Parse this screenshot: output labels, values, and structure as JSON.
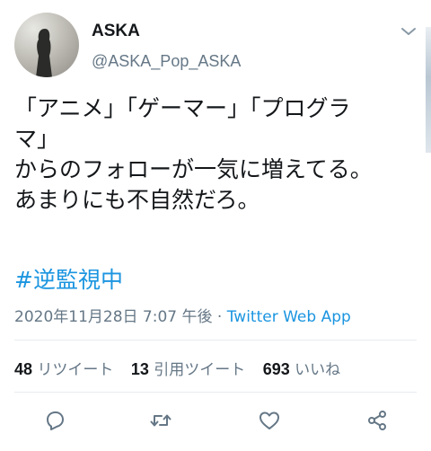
{
  "user": {
    "display_name": "ASKA",
    "handle": "@ASKA_Pop_ASKA",
    "avatar_icon": "silhouette-avatar-icon"
  },
  "tweet": {
    "lines": [
      "「アニメ」「ゲーマー」「プログラ",
      "マ」",
      "からのフォローが一気に増えてる。",
      "あまりにも不自然だろ。"
    ],
    "hashtag": "#逆監視中"
  },
  "meta": {
    "timestamp": "2020年11月28日 7:07 午後",
    "separator": " · ",
    "source": "Twitter Web App"
  },
  "stats": {
    "retweets_count": "48",
    "retweets_label": "リツイート",
    "quotes_count": "13",
    "quotes_label": "引用ツイート",
    "likes_count": "693",
    "likes_label": "いいね"
  },
  "actions": {
    "reply_icon": "reply-icon",
    "retweet_icon": "retweet-icon",
    "like_icon": "heart-icon",
    "share_icon": "share-icon"
  },
  "colors": {
    "text": "#14171a",
    "secondary": "#657786",
    "link": "#1b95e0",
    "divider": "#e6ecf0"
  }
}
